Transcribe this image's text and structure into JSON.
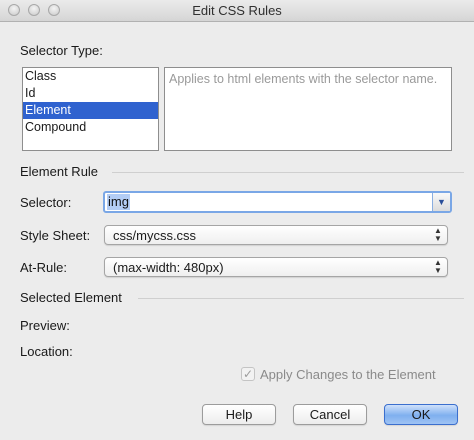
{
  "window": {
    "title": "Edit CSS Rules"
  },
  "selector_type": {
    "label": "Selector Type:",
    "items": [
      "Class",
      "Id",
      "Element",
      "Compound"
    ],
    "selected": "Element",
    "description": "Applies to html elements with the selector name."
  },
  "element_rule": {
    "heading": "Element Rule",
    "selector_label": "Selector:",
    "selector_value": "img",
    "stylesheet_label": "Style Sheet:",
    "stylesheet_value": "css/mycss.css",
    "atrule_label": "At-Rule:",
    "atrule_value": "(max-width: 480px)"
  },
  "selected_element": {
    "heading": "Selected Element",
    "preview_label": "Preview:",
    "location_label": "Location:",
    "apply_label": "Apply Changes to the Element",
    "apply_checked": true
  },
  "buttons": {
    "help": "Help",
    "cancel": "Cancel",
    "ok": "OK"
  },
  "icons": {
    "close": "close-icon",
    "minimize": "minimize-icon",
    "zoom": "zoom-icon",
    "dropdown": "chevron-down-icon",
    "updown": "updown-arrows-icon",
    "check": "checkmark-icon"
  },
  "colors": {
    "selection": "#2f62cf",
    "focus_ring": "#7aa7e6",
    "primary_button": "#7fb0ef"
  }
}
